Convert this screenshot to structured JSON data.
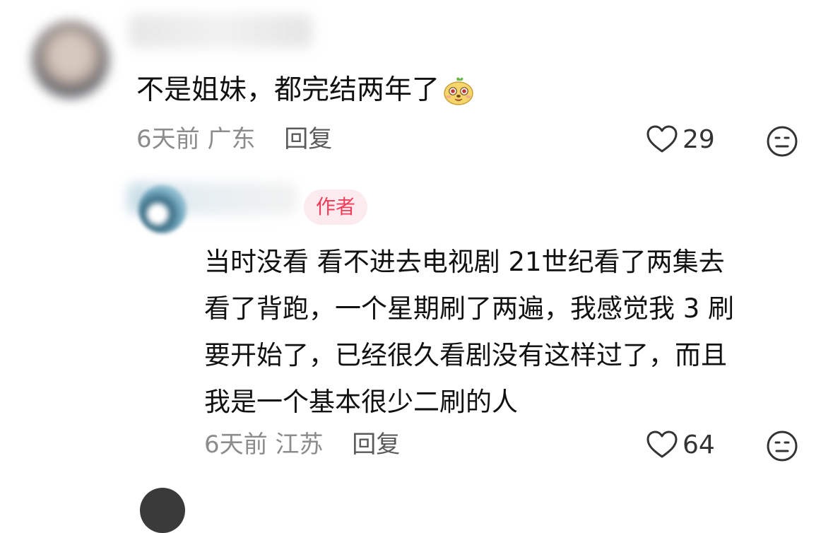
{
  "comments": [
    {
      "text": "不是姐妹，都完结两年了",
      "emoji": "smiley-emoji",
      "time": "6天前",
      "location": "广东",
      "reply_label": "回复",
      "likes": "29"
    },
    {
      "author_badge": "作者",
      "text": "当时没看 看不进去电视剧   21世纪看了两集去\n看了背跑，一个星期刷了两遍，我感觉我 3 刷\n要开始了，已经很久看剧没有这样过了，而且\n我是一个基本很少二刷的人",
      "time": "6天前",
      "location": "江苏",
      "reply_label": "回复",
      "likes": "64"
    }
  ],
  "icons": {
    "like": "heart-outline-icon",
    "dislike": "dislike-face-icon"
  },
  "colors": {
    "text": "#111111",
    "meta": "#8c8c8c",
    "badge_bg": "#fcebee",
    "badge_text": "#f03d5a"
  }
}
